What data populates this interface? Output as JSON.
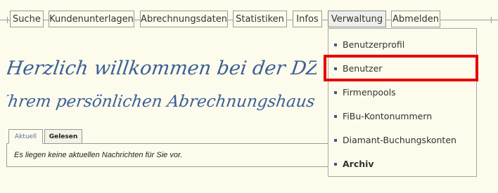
{
  "nav": {
    "items": [
      {
        "label": "Suche"
      },
      {
        "label": "Kundenunterlagen"
      },
      {
        "label": "Abrechnungsdaten"
      },
      {
        "label": "Statistiken"
      },
      {
        "label": "Infos"
      },
      {
        "label": "Verwaltung"
      },
      {
        "label": "Abmelden"
      }
    ]
  },
  "dropdown": {
    "items": [
      {
        "label": "Benutzerprofil"
      },
      {
        "label": "Benutzer"
      },
      {
        "label": "Firmenpools"
      },
      {
        "label": "FiBu-Kontonummern"
      },
      {
        "label": "Diamant-Buchungskonten"
      },
      {
        "label": "Archiv"
      }
    ]
  },
  "welcome": {
    "line1": "Herzlich willkommen bei der DZH",
    "line2": "Ihrem persönlichen Abrechnungshaus"
  },
  "messages": {
    "tabs": [
      {
        "label": "Aktuell"
      },
      {
        "label": "Gelesen"
      }
    ],
    "empty_text": "Es liegen keine aktuellen Nachrichten für Sie vor."
  },
  "colors": {
    "background": "#fdfbec",
    "handwriting": "#3a6096",
    "bullet": "#3a5a8c",
    "highlight": "#e60000"
  }
}
